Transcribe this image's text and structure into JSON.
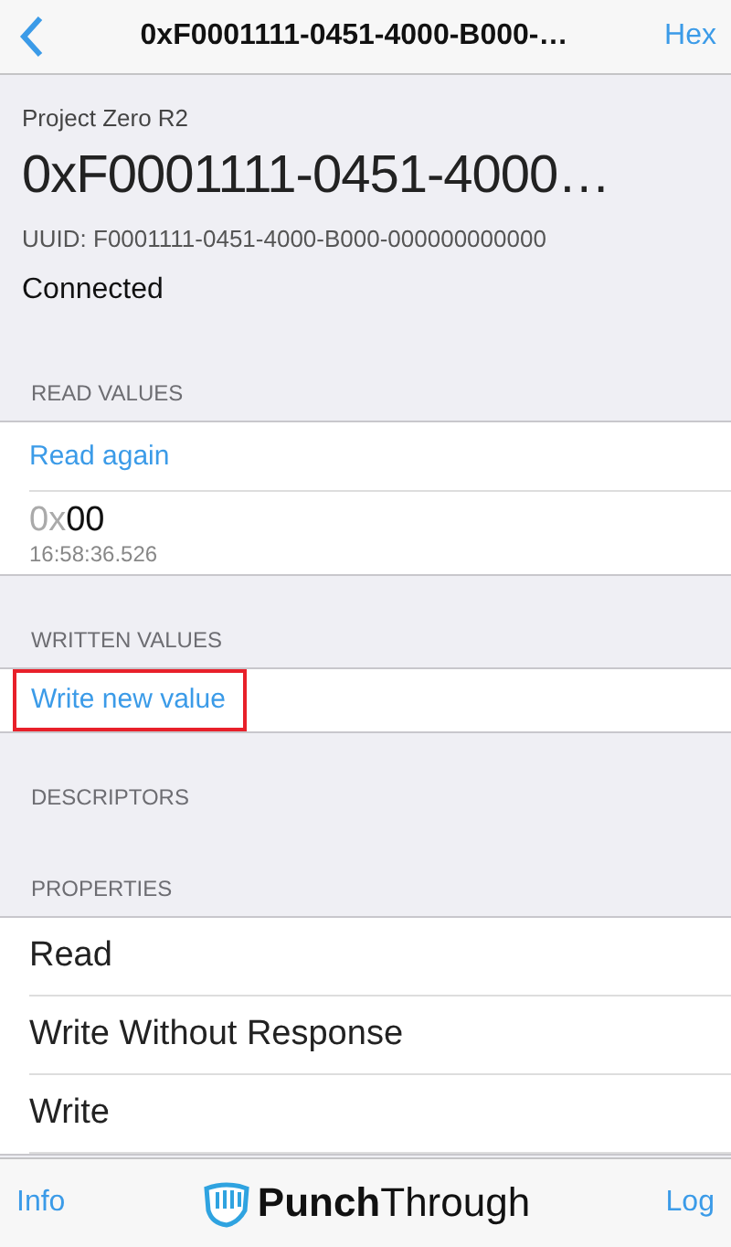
{
  "nav_bar": {
    "back": true,
    "title": "0xF0001111-0451-4000-B000-…",
    "action": "Hex"
  },
  "header": {
    "device": "Project Zero R2",
    "characteristic": "0xF0001111-0451-4000…",
    "uuid": "UUID: F0001111-0451-4000-B000-000000000000",
    "status": "Connected"
  },
  "read_values": {
    "heading": "READ VALUES",
    "action": "Read again",
    "values": [
      {
        "prefix": "0x",
        "value": "00",
        "time": "16:58:36.526"
      }
    ]
  },
  "written_values": {
    "heading": "WRITTEN VALUES",
    "action": "Write new value",
    "highlighted": true
  },
  "descriptors": {
    "heading": "DESCRIPTORS"
  },
  "properties": {
    "heading": "PROPERTIES",
    "items": [
      "Read",
      "Write Without Response",
      "Write"
    ]
  },
  "tab_bar": {
    "left": "Info",
    "logo": "**Punch**Through",
    "right": "Log"
  }
}
